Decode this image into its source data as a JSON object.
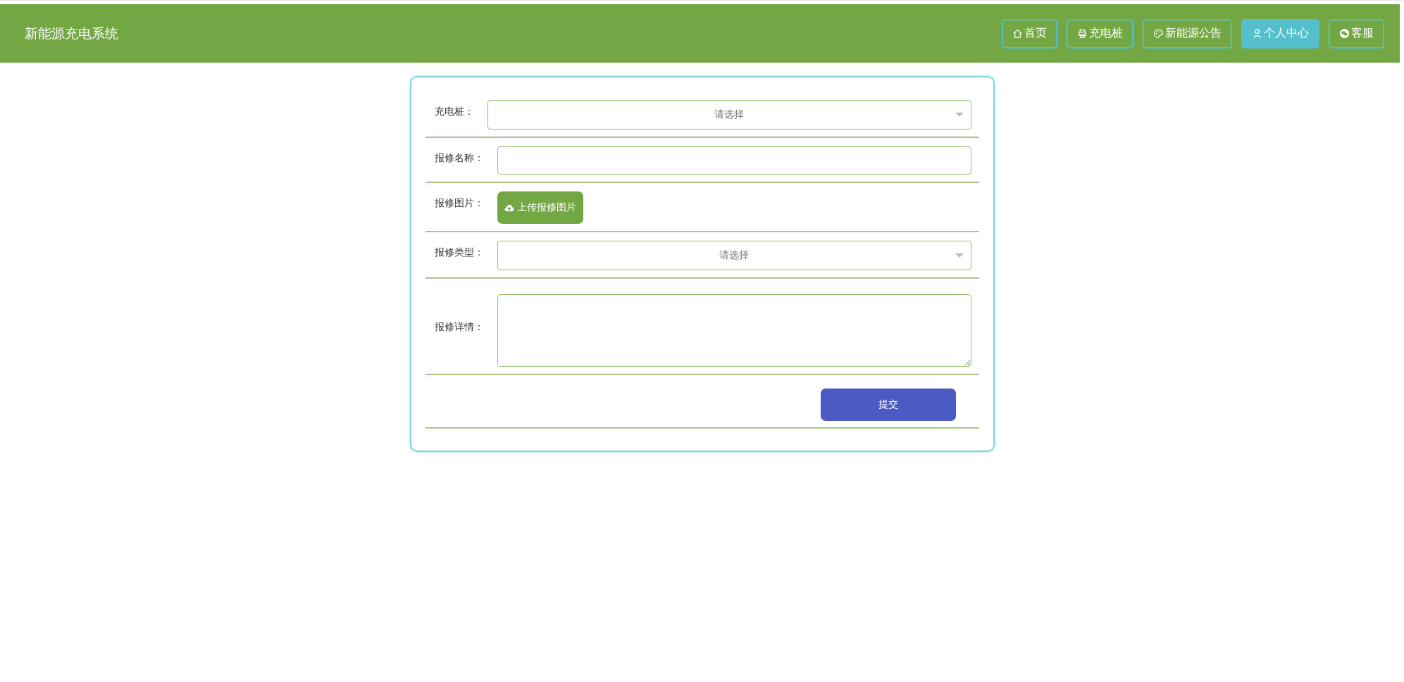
{
  "header": {
    "title": "新能源充电系统"
  },
  "nav": [
    {
      "label": "首页",
      "selected": false
    },
    {
      "label": "充电桩",
      "selected": false
    },
    {
      "label": "新能源公告",
      "selected": false
    },
    {
      "label": "个人中心",
      "selected": true
    },
    {
      "label": "客服",
      "selected": false
    }
  ],
  "form": {
    "rows": [
      {
        "kind": "select",
        "label": "充电桩：",
        "placeholder": "请选择"
      },
      {
        "kind": "input",
        "label": "报修名称："
      },
      {
        "kind": "upload",
        "label": "报修图片：",
        "button": "上传报修图片"
      },
      {
        "kind": "select",
        "label": "报修类型：",
        "placeholder": "请选择"
      },
      {
        "kind": "textarea",
        "label": "报修详情："
      }
    ],
    "submit": "提交"
  }
}
